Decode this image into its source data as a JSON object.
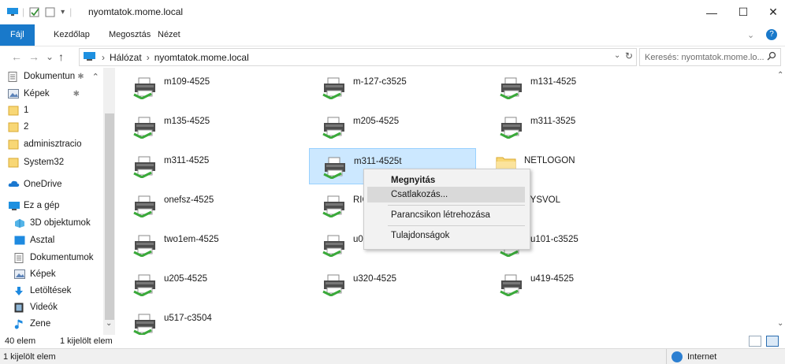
{
  "window": {
    "title": "nyomtatok.mome.local"
  },
  "ribbon": {
    "tabs": [
      "Fájl",
      "Kezdőlap",
      "Megosztás",
      "Nézet"
    ]
  },
  "address": {
    "path": [
      "Hálózat",
      "nyomtatok.mome.local"
    ]
  },
  "search": {
    "placeholder": "Keresés: nyomtatok.mome.lo..."
  },
  "sidebar": {
    "items": [
      {
        "label": "Dokumentun",
        "icon": "document-icon",
        "pinned": true
      },
      {
        "label": "Képek",
        "icon": "pictures-icon",
        "pinned": true
      },
      {
        "label": "1",
        "icon": "folder-icon"
      },
      {
        "label": "2",
        "icon": "folder-icon"
      },
      {
        "label": "adminisztracio",
        "icon": "folder-icon"
      },
      {
        "label": "System32",
        "icon": "folder-icon"
      },
      {
        "label": "OneDrive",
        "icon": "onedrive-icon"
      },
      {
        "label": "Ez a gép",
        "icon": "computer-icon"
      },
      {
        "label": "3D objektumok",
        "icon": "3d-objects-icon"
      },
      {
        "label": "Asztal",
        "icon": "desktop-icon"
      },
      {
        "label": "Dokumentumok",
        "icon": "document-icon"
      },
      {
        "label": "Képek",
        "icon": "pictures-icon"
      },
      {
        "label": "Letöltések",
        "icon": "download-icon"
      },
      {
        "label": "Videók",
        "icon": "video-icon"
      },
      {
        "label": "Zene",
        "icon": "music-icon"
      }
    ]
  },
  "items": [
    {
      "label": "m109-4525",
      "type": "printer"
    },
    {
      "label": "m-127-c3525",
      "type": "printer"
    },
    {
      "label": "m131-4525",
      "type": "printer"
    },
    {
      "label": "m135-4525",
      "type": "printer"
    },
    {
      "label": "m205-4525",
      "type": "printer"
    },
    {
      "label": "m311-3525",
      "type": "printer"
    },
    {
      "label": "m311-4525",
      "type": "printer"
    },
    {
      "label": "m311-4525t",
      "type": "printer",
      "selected": true
    },
    {
      "label": "NETLOGON",
      "type": "folder"
    },
    {
      "label": "onefsz-4525",
      "type": "printer"
    },
    {
      "label": "RICOH",
      "type": "printer"
    },
    {
      "label": "SYSVOL",
      "type": "folder"
    },
    {
      "label": "two1em-4525",
      "type": "printer"
    },
    {
      "label": "u006-4525",
      "type": "printer"
    },
    {
      "label": "u101-c3525",
      "type": "printer"
    },
    {
      "label": "u205-4525",
      "type": "printer"
    },
    {
      "label": "u320-4525",
      "type": "printer"
    },
    {
      "label": "u419-4525",
      "type": "printer"
    },
    {
      "label": "u517-c3504",
      "type": "printer"
    }
  ],
  "context_menu": {
    "items": [
      "Megnyitás",
      "Csatlakozás...",
      "Parancsikon létrehozása",
      "Tulajdonságok"
    ]
  },
  "status": {
    "count": "40 elem",
    "selected": "1 kijelölt elem",
    "bottom": "1 kijelölt elem",
    "zone": "Internet"
  },
  "colors": {
    "accent": "#1979ca",
    "selection_bg": "#cce8ff",
    "selection_border": "#99d1ff"
  }
}
